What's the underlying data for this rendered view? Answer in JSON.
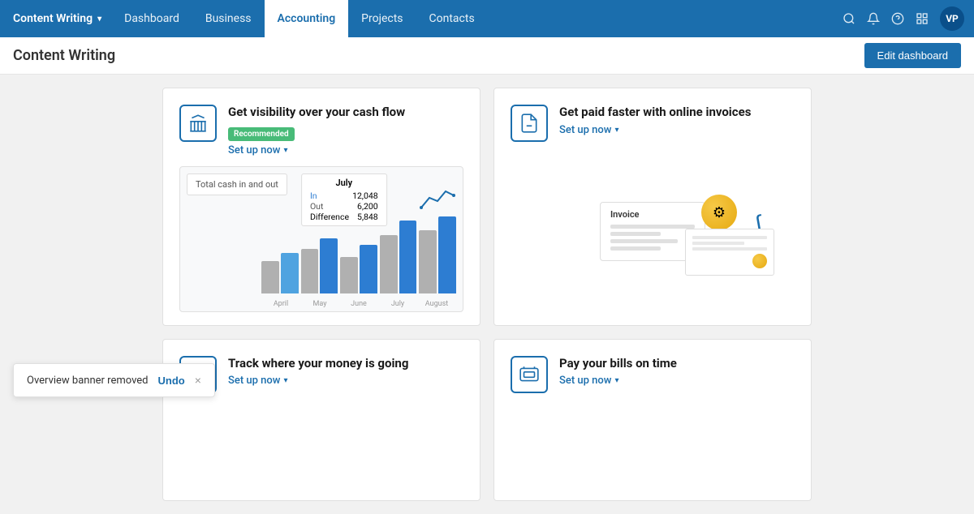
{
  "nav": {
    "brand": "Content Writing",
    "chevron": "▾",
    "links": [
      {
        "label": "Dashboard",
        "active": false
      },
      {
        "label": "Business",
        "active": false
      },
      {
        "label": "Accounting",
        "active": true
      },
      {
        "label": "Projects",
        "active": false
      },
      {
        "label": "Contacts",
        "active": false
      }
    ],
    "avatar": "VP"
  },
  "subheader": {
    "title": "Content Writing",
    "edit_button": "Edit dashboard"
  },
  "cards": [
    {
      "id": "cash-flow",
      "icon": "bank",
      "title": "Get visibility over your cash flow",
      "badge": "Recommended",
      "setup_label": "Set up now",
      "has_chart": true
    },
    {
      "id": "online-invoices",
      "icon": "invoice",
      "title": "Get paid faster with online invoices",
      "badge": null,
      "setup_label": "Set up now",
      "has_chart": false
    },
    {
      "id": "money-tracking",
      "icon": "chart",
      "title": "Track where your money is going",
      "badge": null,
      "setup_label": "Set up now",
      "has_chart": false
    },
    {
      "id": "bills",
      "icon": "bills",
      "title": "Pay your bills on time",
      "badge": null,
      "setup_label": "Set up now",
      "has_chart": false
    }
  ],
  "chart": {
    "tooltip_main": "Total cash in and out",
    "month": "July",
    "in_label": "In",
    "out_label": "Out",
    "diff_label": "Difference",
    "in_value": "12,048",
    "out_value": "6,200",
    "diff_value": "5,848",
    "months": [
      "April",
      "May",
      "June",
      "July",
      "August"
    ],
    "bars": [
      {
        "in": 40,
        "out": 30
      },
      {
        "in": 55,
        "out": 45
      },
      {
        "in": 50,
        "out": 38
      },
      {
        "in": 75,
        "out": 60
      },
      {
        "in": 80,
        "out": 65
      }
    ]
  },
  "toast": {
    "message": "Overview banner removed",
    "undo_label": "Undo",
    "close_label": "×"
  }
}
